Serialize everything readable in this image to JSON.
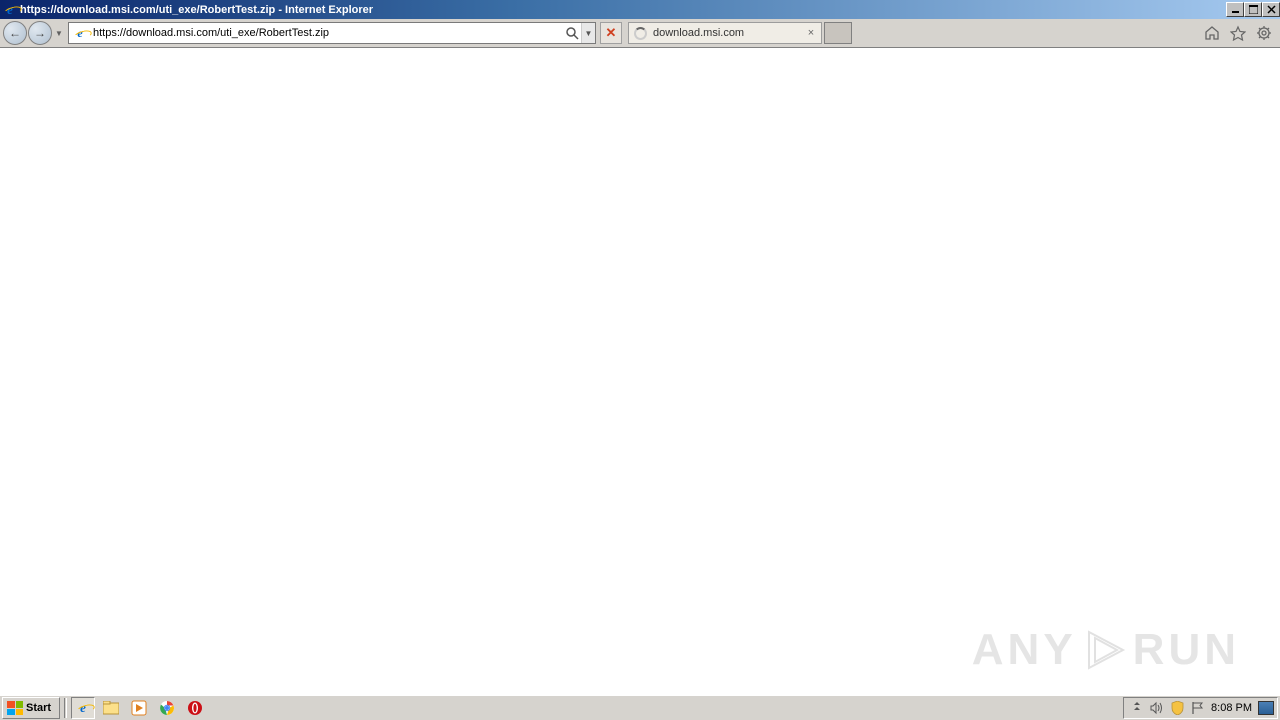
{
  "window": {
    "title": "https://download.msi.com/uti_exe/RobertTest.zip - Internet Explorer"
  },
  "nav": {
    "url": "https://download.msi.com/uti_exe/RobertTest.zip"
  },
  "tab": {
    "title": "download.msi.com"
  },
  "watermark": {
    "left": "ANY",
    "right": "RUN"
  },
  "taskbar": {
    "start": "Start",
    "time": "8:08 PM"
  }
}
